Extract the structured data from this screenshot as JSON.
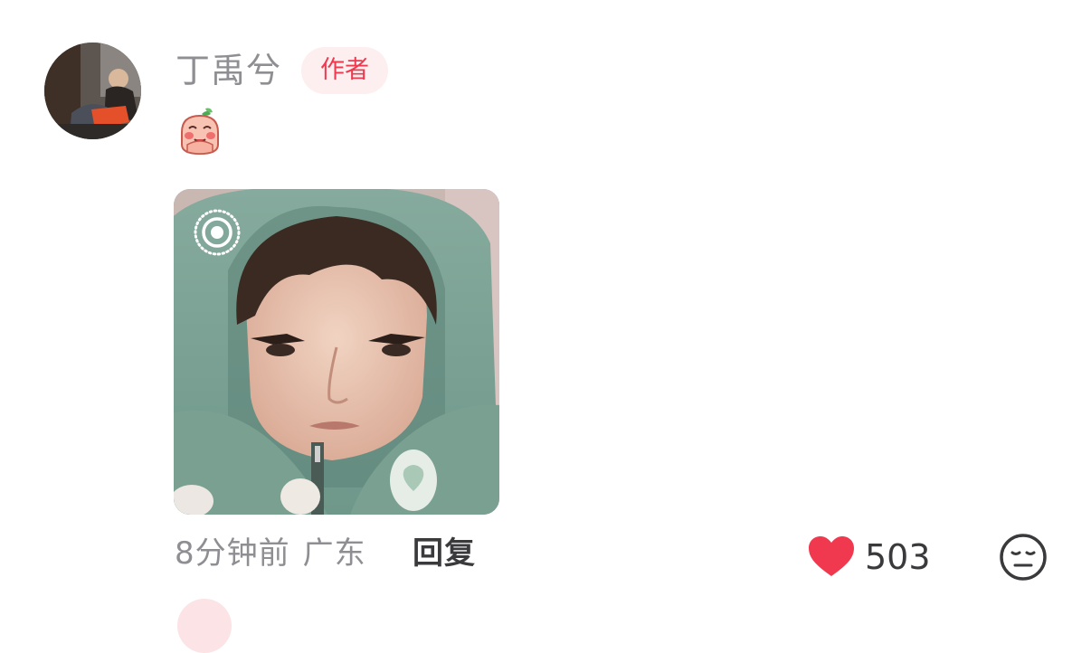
{
  "comment": {
    "author": {
      "name": "丁禹兮",
      "badge": "作者",
      "avatar_icon": "avatar-photo"
    },
    "sticker_icon": "peach-bow-sticker",
    "photo": {
      "live_icon": "live-photo-icon"
    },
    "time": "8分钟前",
    "location": "广东",
    "reply_label": "回复",
    "like_count": "503",
    "like_icon": "heart-icon",
    "reaction_icon": "neutral-face-icon"
  },
  "colors": {
    "badge_bg": "#fdeef0",
    "badge_text": "#f0394f",
    "heart": "#f0394f",
    "muted_text": "#8e8e93",
    "dark_text": "#3a3a3c"
  }
}
